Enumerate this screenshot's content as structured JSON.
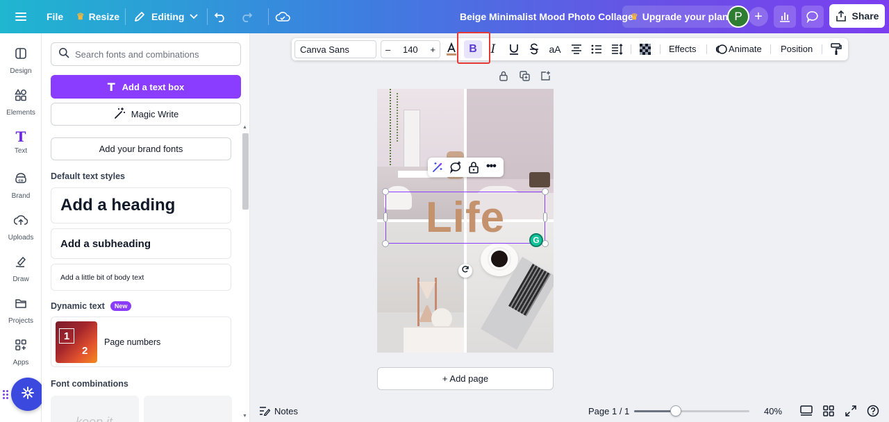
{
  "topbar": {
    "file_label": "File",
    "resize_label": "Resize",
    "editing_label": "Editing",
    "document_title": "Beige Minimalist Mood Photo Collage",
    "upgrade_label": "Upgrade your plan",
    "avatar_initial": "P",
    "share_label": "Share"
  },
  "rail": {
    "items": [
      {
        "label": "Design"
      },
      {
        "label": "Elements"
      },
      {
        "label": "Text"
      },
      {
        "label": "Brand"
      },
      {
        "label": "Uploads"
      },
      {
        "label": "Draw"
      },
      {
        "label": "Projects"
      },
      {
        "label": "Apps"
      }
    ]
  },
  "panel": {
    "search_placeholder": "Search fonts and combinations",
    "add_text_box": "Add a text box",
    "magic_write": "Magic Write",
    "brand_fonts": "Add your brand fonts",
    "default_styles_heading": "Default text styles",
    "heading_style": "Add a heading",
    "subheading_style": "Add a subheading",
    "body_style": "Add a little bit of body text",
    "dynamic_text_heading": "Dynamic text",
    "new_badge": "New",
    "page_numbers": "Page numbers",
    "page_numbers_digit_1": "1",
    "page_numbers_digit_2": "2",
    "font_combinations_heading": "Font combinations",
    "combo_preview": "keep it"
  },
  "editbar": {
    "font_name": "Canva Sans",
    "font_size": "140",
    "bold": "B",
    "italic": "I",
    "case_toggle": "aA",
    "effects": "Effects",
    "animate": "Animate",
    "position": "Position"
  },
  "canvas": {
    "text_content": "Life"
  },
  "add_page_label": "+ Add page",
  "bottombar": {
    "notes_label": "Notes",
    "page_indicator": "Page 1 / 1",
    "zoom_level": "40%",
    "zoom_fraction": 0.36
  },
  "colors": {
    "accent": "#8b3dff",
    "text_color": "#c4926d"
  }
}
